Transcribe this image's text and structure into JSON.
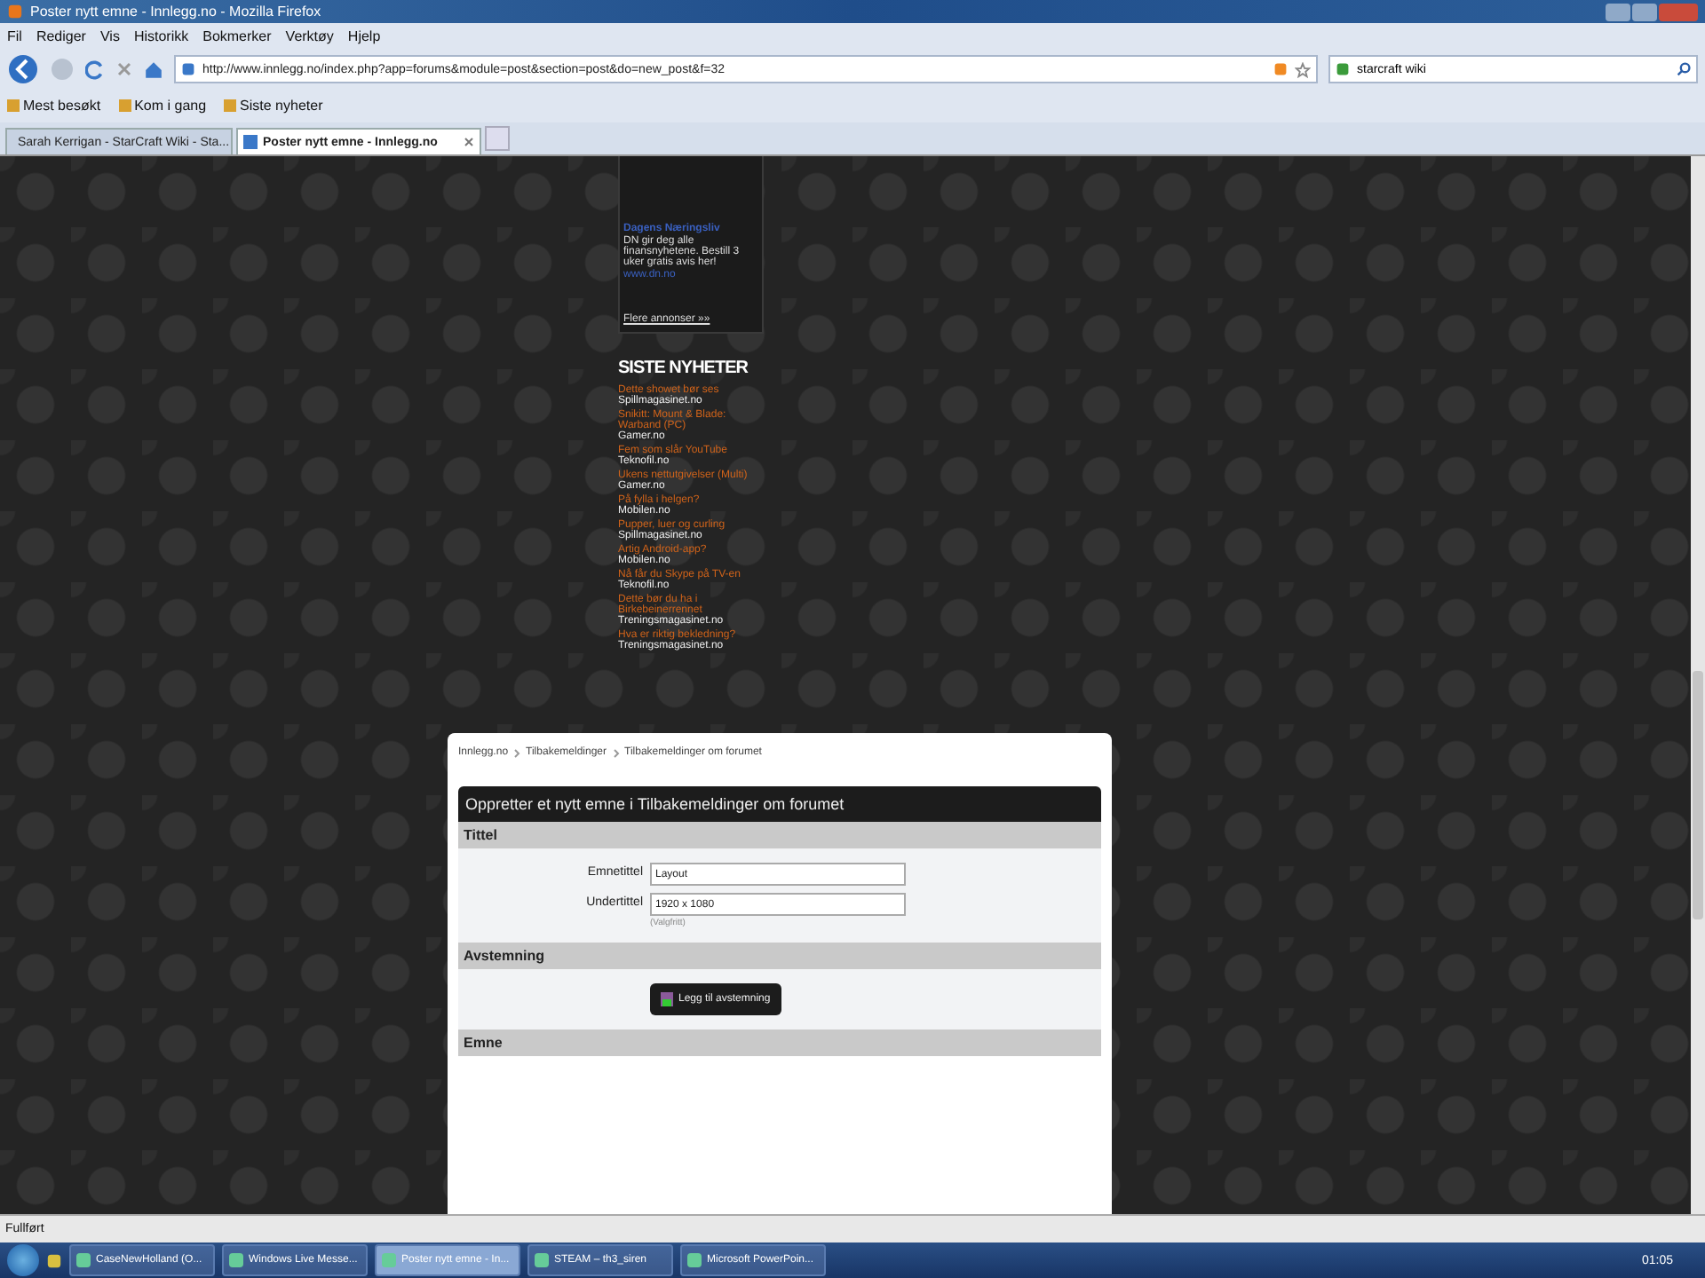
{
  "window": {
    "title": "Poster nytt emne - Innlegg.no - Mozilla Firefox"
  },
  "menu": [
    "Fil",
    "Rediger",
    "Vis",
    "Historikk",
    "Bokmerker",
    "Verktøy",
    "Hjelp"
  ],
  "nav": {
    "url": "http://www.innlegg.no/index.php?app=forums&module=post&section=post&do=new_post&f=32",
    "search": "starcraft wiki"
  },
  "bookmarks": [
    "Mest besøkt",
    "Kom i gang",
    "Siste nyheter"
  ],
  "tabs": [
    {
      "label": "Sarah Kerrigan - StarCraft Wiki - Sta...",
      "selected": false
    },
    {
      "label": "Poster nytt emne - Innlegg.no",
      "selected": true
    }
  ],
  "ad": {
    "title": "Dagens Næringsliv",
    "text": "DN gir deg alle finansnyhetene. Bestill 3 uker gratis avis her!",
    "link": "www.dn.no",
    "more": "Flere annonser »»"
  },
  "news": {
    "heading": "SISTE NYHETER",
    "items": [
      {
        "title": "Dette showet bør ses",
        "source": "Spillmagasinet.no"
      },
      {
        "title": "Snikitt: Mount & Blade: Warband (PC)",
        "source": "Gamer.no"
      },
      {
        "title": "Fem som slår YouTube",
        "source": "Teknofil.no"
      },
      {
        "title": "Ukens nettutgivelser (Multi)",
        "source": "Gamer.no"
      },
      {
        "title": "På fylla i helgen?",
        "source": "Mobilen.no"
      },
      {
        "title": "Pupper, luer og curling",
        "source": "Spillmagasinet.no"
      },
      {
        "title": "Artig Android-app?",
        "source": "Mobilen.no"
      },
      {
        "title": "Nå får du Skype på TV-en",
        "source": "Teknofil.no"
      },
      {
        "title": "Dette bør du ha i Birkebeinerrennet",
        "source": "Treningsmagasinet.no"
      },
      {
        "title": "Hva er riktig bekledning?",
        "source": "Treningsmagasinet.no"
      }
    ]
  },
  "breadcrumb": [
    "Innlegg.no",
    "Tilbakemeldinger",
    "Tilbakemeldinger om forumet"
  ],
  "form": {
    "heading": "Oppretter et nytt emne i Tilbakemeldinger om forumet",
    "sections": [
      {
        "title": "Tittel",
        "kind": "fields",
        "fields": [
          {
            "label": "Emnetittel",
            "value": "Layout"
          },
          {
            "label": "Undertittel",
            "value": "1920 x 1080",
            "hint": "(Valgfritt)"
          }
        ]
      },
      {
        "title": "Avstemning",
        "kind": "button",
        "button": "Legg til avstemning"
      },
      {
        "title": "Emne",
        "kind": "empty"
      }
    ]
  },
  "status_bar": "Fullført",
  "taskbar": [
    {
      "label": "CaseNewHolland (O...",
      "selected": false
    },
    {
      "label": "Windows Live Messe...",
      "selected": false
    },
    {
      "label": "Poster nytt emne - In...",
      "selected": true
    },
    {
      "label": "STEAM – th3_siren",
      "selected": false
    },
    {
      "label": "Microsoft PowerPoin...",
      "selected": false
    }
  ],
  "clock": "01:05"
}
